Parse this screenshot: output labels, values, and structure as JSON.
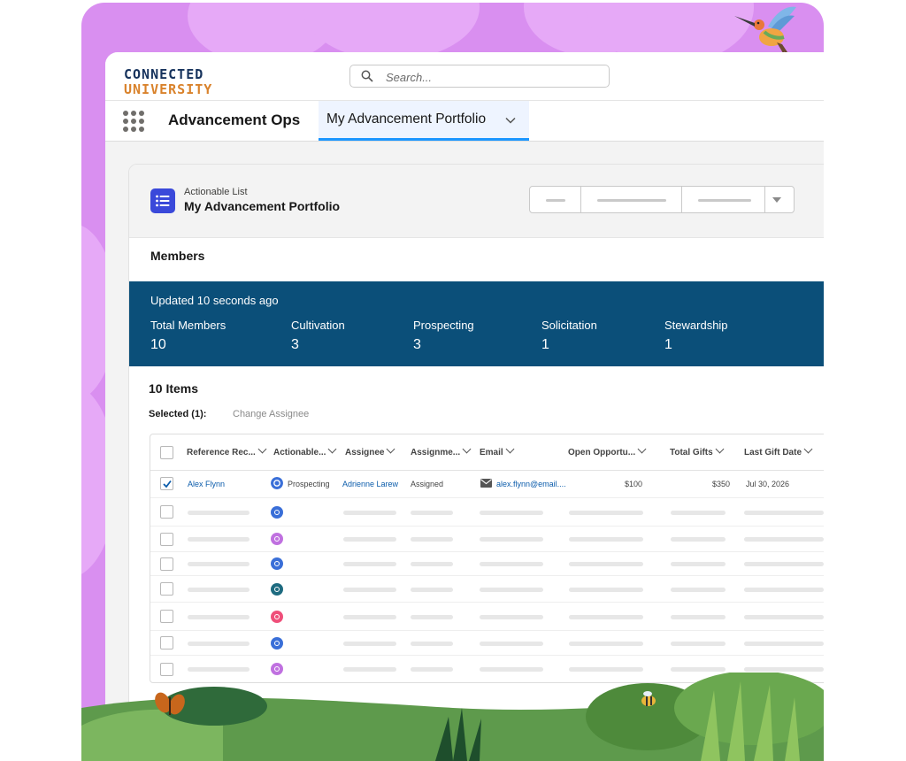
{
  "brand": {
    "line1": "CONNECTED",
    "line2": "UNIVERSITY"
  },
  "search": {
    "placeholder": "Search..."
  },
  "nav": {
    "app_name": "Advancement Ops",
    "active_tab": "My Advancement Portfolio"
  },
  "header": {
    "object_type": "Actionable List",
    "title": "My Advancement Portfolio"
  },
  "section_title": "Members",
  "stats": {
    "updated": "Updated 10 seconds ago",
    "items": [
      {
        "label": "Total Members",
        "value": "10"
      },
      {
        "label": "Cultivation",
        "value": "3"
      },
      {
        "label": "Prospecting",
        "value": "3"
      },
      {
        "label": "Solicitation",
        "value": "1"
      },
      {
        "label": "Stewardship",
        "value": "1"
      }
    ]
  },
  "list": {
    "count_label": "10 Items",
    "selected_label": "Selected (1):",
    "change_assignee": "Change Assignee"
  },
  "table": {
    "columns": [
      "Reference Rec...",
      "Actionable...",
      "Assignee",
      "Assignme...",
      "Email",
      "Open Opportu...",
      "Total Gifts",
      "Last Gift Date"
    ],
    "first_row": {
      "name": "Alex Flynn",
      "actionable": "Prospecting",
      "assignee": "Adrienne Larew",
      "assignment": "Assigned",
      "email": "alex.flynn@email....",
      "open_opportunities": "$100",
      "total_gifts": "$350",
      "last_gift_date": "Jul 30, 2026"
    },
    "row_icons": [
      "blue-badge-icon",
      "purple-mail-icon",
      "blue-badge-icon",
      "teal-phone-icon",
      "pink-heart-icon",
      "blue-badge-icon",
      "purple-mail-icon"
    ]
  },
  "colors": {
    "stats_band": "#0b4f79",
    "brand_blue": "#16325c",
    "brand_orange": "#d9822b",
    "tab_underline": "#1b96ff",
    "frame": "#d98ff0"
  }
}
